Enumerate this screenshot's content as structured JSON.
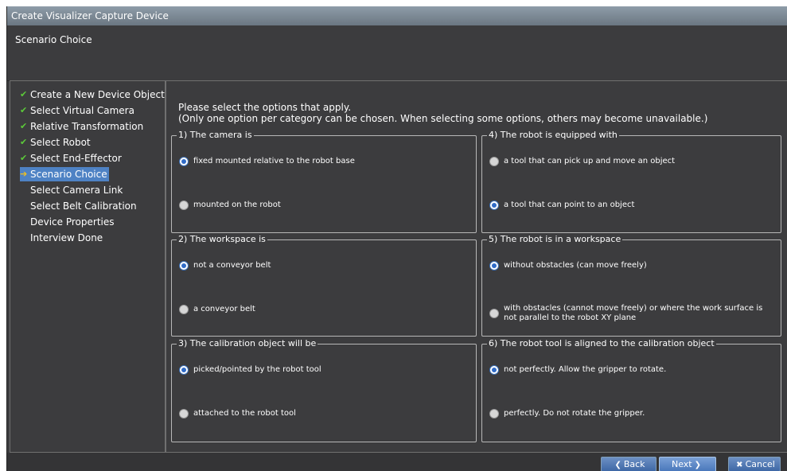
{
  "window": {
    "title": "Create Visualizer Capture Device"
  },
  "header": {
    "subtitle": "Scenario Choice"
  },
  "steps": [
    {
      "label": "Create a New Device Object",
      "state": "done"
    },
    {
      "label": "Select Virtual Camera",
      "state": "done"
    },
    {
      "label": "Relative Transformation",
      "state": "done"
    },
    {
      "label": "Select Robot",
      "state": "done"
    },
    {
      "label": "Select End-Effector",
      "state": "done"
    },
    {
      "label": "Scenario Choice",
      "state": "active"
    },
    {
      "label": "Select Camera Link",
      "state": "pending"
    },
    {
      "label": "Select Belt Calibration",
      "state": "pending"
    },
    {
      "label": "Device Properties",
      "state": "pending"
    },
    {
      "label": "Interview Done",
      "state": "pending"
    }
  ],
  "main": {
    "intro_line1": "Please select the options that apply.",
    "intro_line2": "(Only one option per category can be chosen. When selecting some options, others may become unavailable.)"
  },
  "groups": [
    {
      "title": "1) The camera is",
      "options": [
        {
          "label": "fixed mounted relative to the robot base",
          "checked": true
        },
        {
          "label": "mounted on the robot",
          "checked": false
        }
      ]
    },
    {
      "title": "2) The workspace is",
      "options": [
        {
          "label": "not a conveyor belt",
          "checked": true
        },
        {
          "label": "a conveyor belt",
          "checked": false
        }
      ]
    },
    {
      "title": "3) The calibration object will be",
      "options": [
        {
          "label": "picked/pointed by the robot tool",
          "checked": true
        },
        {
          "label": "attached to the robot tool",
          "checked": false
        }
      ]
    },
    {
      "title": "4) The robot is equipped with",
      "options": [
        {
          "label": "a tool that can pick up and move an object",
          "checked": false
        },
        {
          "label": "a tool that can point to an object",
          "checked": true
        }
      ]
    },
    {
      "title": "5) The robot is in a workspace",
      "options": [
        {
          "label": "without obstacles (can move freely)",
          "checked": true
        },
        {
          "label": "with obstacles (cannot move freely) or where the work surface is not parallel to the robot XY plane",
          "checked": false
        }
      ]
    },
    {
      "title": "6) The robot tool is aligned to the calibration object",
      "options": [
        {
          "label": "not perfectly. Allow the gripper to rotate.",
          "checked": true
        },
        {
          "label": "perfectly. Do not rotate the gripper.",
          "checked": false
        }
      ]
    }
  ],
  "footer": {
    "back_label": "Back",
    "next_label": "Next",
    "cancel_label": "Cancel"
  },
  "icons": {
    "done": "check-icon",
    "active": "arrow-right-icon",
    "back": "back-arrow-icon",
    "next": "next-arrow-icon",
    "cancel": "x-icon"
  },
  "colors": {
    "accent": "#4e82c4",
    "check": "#5cc93a",
    "active_marker": "#f0c020",
    "background": "#3c3c3e"
  }
}
